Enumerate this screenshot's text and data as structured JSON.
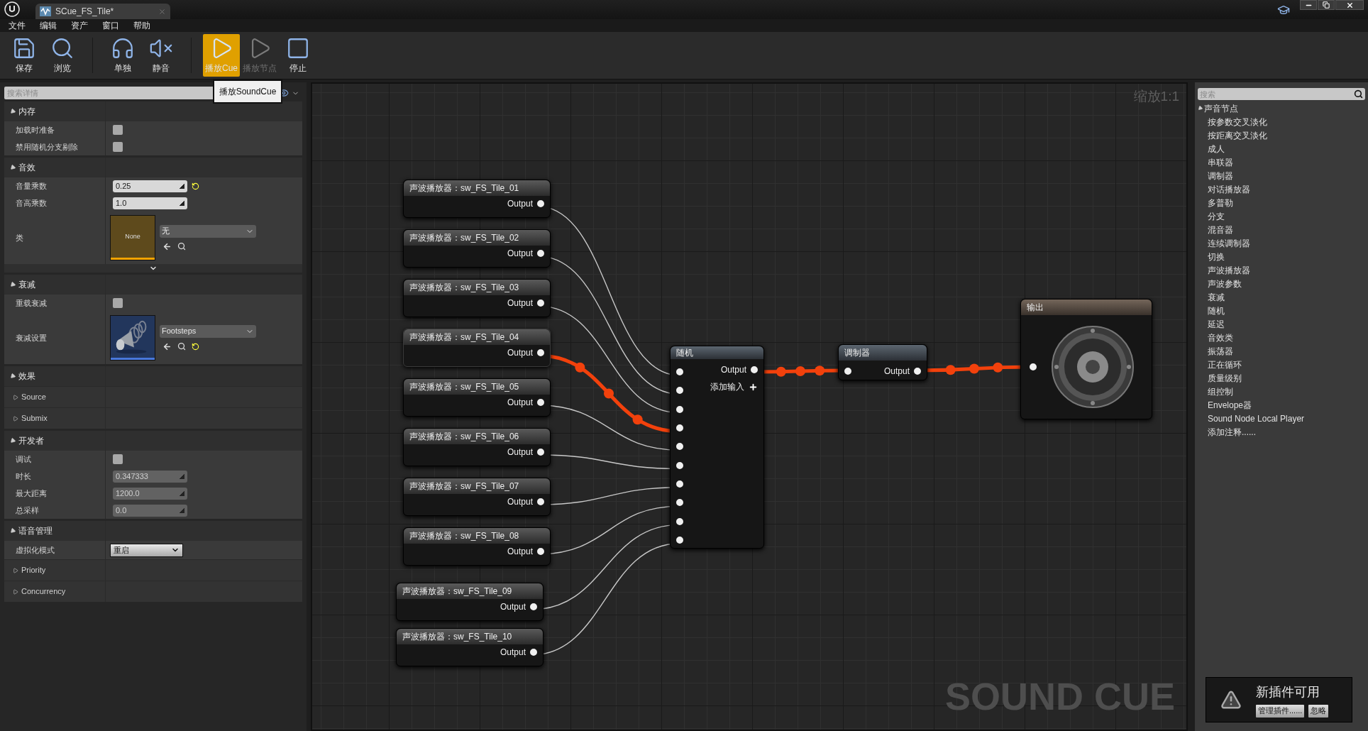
{
  "window": {
    "tab_title": "SCue_FS_Tile*"
  },
  "menu": [
    "文件",
    "编辑",
    "资产",
    "窗口",
    "帮助"
  ],
  "toolbar": [
    {
      "kind": "save",
      "label": "保存",
      "selected": false,
      "disabled": false
    },
    {
      "kind": "browse",
      "label": "浏览",
      "selected": false,
      "disabled": false
    },
    {
      "kind": "solo",
      "label": "单独",
      "selected": false,
      "disabled": false
    },
    {
      "kind": "mute",
      "label": "静音",
      "selected": false,
      "disabled": false
    },
    {
      "kind": "play_cue",
      "label": "播放Cue",
      "selected": true,
      "disabled": false
    },
    {
      "kind": "play_node",
      "label": "播放节点",
      "selected": false,
      "disabled": true
    },
    {
      "kind": "stop",
      "label": "停止",
      "selected": false,
      "disabled": false
    }
  ],
  "tooltip": "播放SoundCue",
  "details": {
    "search": {
      "placeholder": "搜索详情"
    },
    "sections": [
      {
        "title": "内存",
        "expanded": true,
        "rows": [
          {
            "kind": "checkbox",
            "label": "加载时准备",
            "checked": false
          },
          {
            "kind": "checkbox",
            "label": "禁用随机分支剔除",
            "checked": false
          }
        ]
      },
      {
        "title": "音效",
        "expanded": true,
        "advanced": true,
        "rows": [
          {
            "kind": "number",
            "label": "音量乘数",
            "value": "0.25",
            "disabled": false,
            "reset": true
          },
          {
            "kind": "number",
            "label": "音高乘数",
            "value": "1.0",
            "disabled": false,
            "reset": false
          },
          {
            "kind": "asset",
            "label": "类",
            "thumb_label": "None",
            "value": "无",
            "reset": false
          }
        ]
      },
      {
        "title": "衰减",
        "expanded": true,
        "rows": [
          {
            "kind": "checkbox",
            "label": "重载衰减",
            "checked": false
          },
          {
            "kind": "asset",
            "label": "衰减设置",
            "value": "Footsteps",
            "reset": true
          }
        ]
      },
      {
        "title": "效果",
        "expanded": true,
        "rows": [
          {
            "kind": "group",
            "label": "Source",
            "expanded": false
          },
          {
            "kind": "group",
            "label": "Submix",
            "expanded": false
          }
        ]
      },
      {
        "title": "开发者",
        "expanded": true,
        "rows": [
          {
            "kind": "checkbox",
            "label": "调试",
            "checked": false
          },
          {
            "kind": "number",
            "label": "时长",
            "value": "0.347333",
            "disabled": true,
            "reset": false
          },
          {
            "kind": "number",
            "label": "最大距离",
            "value": "1200.0",
            "disabled": true,
            "reset": false
          },
          {
            "kind": "number",
            "label": "总采样",
            "value": "0.0",
            "disabled": true,
            "reset": false
          }
        ]
      },
      {
        "title": "语音管理",
        "expanded": true,
        "rows": [
          {
            "kind": "dropdown",
            "label": "虚拟化模式",
            "value": "重启"
          },
          {
            "kind": "group",
            "label": "Priority",
            "expanded": false
          },
          {
            "kind": "group",
            "label": "Concurrency",
            "expanded": false
          }
        ]
      }
    ]
  },
  "graph": {
    "zoom_label": "缩放1:1",
    "watermark": "SOUND CUE",
    "nodes": [
      {
        "kind": "wave_player",
        "title": "声波播放器：sw_FS_Tile_01",
        "output": "Output",
        "playing": false
      },
      {
        "kind": "wave_player",
        "title": "声波播放器：sw_FS_Tile_02",
        "output": "Output",
        "playing": false
      },
      {
        "kind": "wave_player",
        "title": "声波播放器：sw_FS_Tile_03",
        "output": "Output",
        "playing": false
      },
      {
        "kind": "wave_player",
        "title": "声波播放器：sw_FS_Tile_04",
        "output": "Output",
        "playing": true
      },
      {
        "kind": "wave_player",
        "title": "声波播放器：sw_FS_Tile_05",
        "output": "Output",
        "playing": false
      },
      {
        "kind": "wave_player",
        "title": "声波播放器：sw_FS_Tile_06",
        "output": "Output",
        "playing": false
      },
      {
        "kind": "wave_player",
        "title": "声波播放器：sw_FS_Tile_07",
        "output": "Output",
        "playing": false
      },
      {
        "kind": "wave_player",
        "title": "声波播放器：sw_FS_Tile_08",
        "output": "Output",
        "playing": false
      },
      {
        "kind": "wave_player",
        "title": "声波播放器：sw_FS_Tile_09",
        "output": "Output",
        "playing": false
      },
      {
        "kind": "wave_player",
        "title": "声波播放器：sw_FS_Tile_10",
        "output": "Output",
        "playing": false
      },
      {
        "kind": "random",
        "title": "随机",
        "output": "Output",
        "add_input": "添加输入",
        "playing": true
      },
      {
        "kind": "modulator",
        "title": "调制器",
        "output": "Output",
        "playing": true
      },
      {
        "kind": "output",
        "title": "输出"
      }
    ]
  },
  "palette": {
    "search": {
      "placeholder": "搜索"
    },
    "tree": [
      {
        "label": "声音节点",
        "expanded": true,
        "children": [
          {
            "label": "按参数交叉淡化"
          },
          {
            "label": "按距离交叉淡化"
          },
          {
            "label": "成人"
          },
          {
            "label": "串联器"
          },
          {
            "label": "调制器"
          },
          {
            "label": "对话播放器"
          },
          {
            "label": "多普勒"
          },
          {
            "label": "分支"
          },
          {
            "label": "混音器"
          },
          {
            "label": "连续调制器"
          },
          {
            "label": "切换"
          },
          {
            "label": "声波播放器"
          },
          {
            "label": "声波参数"
          },
          {
            "label": "衰减"
          },
          {
            "label": "随机"
          },
          {
            "label": "延迟"
          },
          {
            "label": "音效类"
          },
          {
            "label": "振荡器"
          },
          {
            "label": "正在循环"
          },
          {
            "label": "质量级别"
          },
          {
            "label": "组控制"
          },
          {
            "label": "Envelope器"
          },
          {
            "label": "Sound Node Local Player"
          },
          {
            "label": "添加注释......"
          }
        ]
      }
    ]
  },
  "notification": {
    "title": "新插件可用",
    "buttons": [
      "管理插件......",
      "忽略"
    ]
  }
}
